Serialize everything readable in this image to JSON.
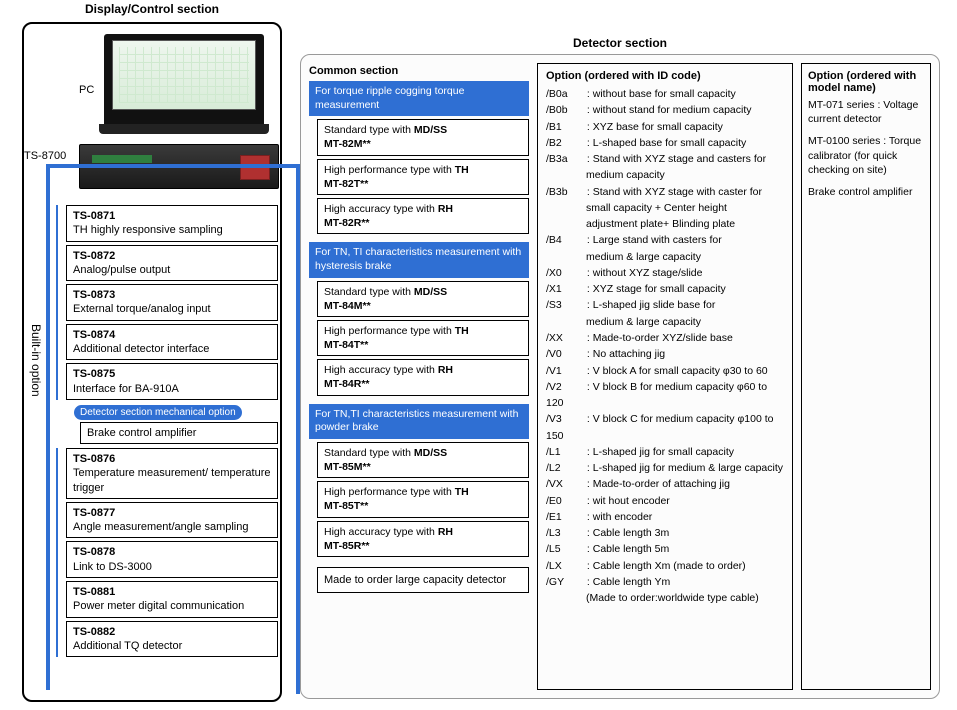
{
  "display": {
    "title": "Display/Control section",
    "pc_label": "PC",
    "ts_label": "TS-8700",
    "vert_label": "Built-in option",
    "options": [
      {
        "code": "TS-0871",
        "desc": "TH highly responsive sampling"
      },
      {
        "code": "TS-0872",
        "desc": "Analog/pulse output"
      },
      {
        "code": "TS-0873",
        "desc": "External torque/analog input"
      },
      {
        "code": "TS-0874",
        "desc": "Additional detector interface"
      },
      {
        "code": "TS-0875",
        "desc": "Interface for BA-910A"
      }
    ],
    "mech_header": "Detector section  mechanical option",
    "brake": "Brake control amplifier",
    "options2": [
      {
        "code": "TS-0876",
        "desc": "Temperature measurement/ temperature trigger"
      },
      {
        "code": "TS-0877",
        "desc": "Angle measurement/angle sampling"
      },
      {
        "code": "TS-0878",
        "desc": "Link to DS-3000"
      },
      {
        "code": "TS-0881",
        "desc": "Power meter digital communication"
      },
      {
        "code": "TS-0882",
        "desc": "Additional TQ detector"
      }
    ]
  },
  "detector": {
    "title": "Detector section",
    "common": {
      "title": "Common section",
      "groups": [
        {
          "head": "For torque ripple cogging torque measurement",
          "items": [
            {
              "label": "Standard type with MD/SS",
              "model": "MT-82M**"
            },
            {
              "label": "High performance type with TH",
              "model": "MT-82T**"
            },
            {
              "label": "High accuracy type with RH",
              "model": "MT-82R**"
            }
          ]
        },
        {
          "head": "For TN, TI characteristics measurement with hysteresis brake",
          "items": [
            {
              "label": "Standard type with MD/SS",
              "model": "MT-84M**"
            },
            {
              "label": "High performance type with TH",
              "model": "MT-84T**"
            },
            {
              "label": "High accuracy type with RH",
              "model": "MT-84R**"
            }
          ]
        },
        {
          "head": "For TN,TI characteristics measurement with powder brake",
          "items": [
            {
              "label": "Standard type with MD/SS",
              "model": "MT-85M**"
            },
            {
              "label": "High performance type with TH",
              "model": "MT-85T**"
            },
            {
              "label": "High accuracy type with RH",
              "model": "MT-85R**"
            }
          ]
        }
      ],
      "made": "Made to order large capacity detector"
    },
    "option": {
      "title": "Option (ordered with ID code)",
      "lines": [
        {
          "code": "/B0a",
          "text": ": without base for small capacity"
        },
        {
          "code": "/B0b",
          "text": ": without stand for medium capacity"
        },
        {
          "code": "/B1",
          "text": ": XYZ base for small capacity"
        },
        {
          "code": "/B2",
          "text": ": L-shaped base for small capacity"
        },
        {
          "code": "/B3a",
          "text": ": Stand with XYZ stage and casters for"
        },
        {
          "sub": "medium capacity"
        },
        {
          "code": "/B3b",
          "text": ": Stand with XYZ stage with caster for"
        },
        {
          "sub": "small capacity + Center height"
        },
        {
          "sub": "adjustment plate+ Blinding plate"
        },
        {
          "code": "/B4",
          "text": ": Large stand with casters for"
        },
        {
          "sub": "medium & large capacity"
        },
        {
          "code": "/X0",
          "text": ": without XYZ stage/slide"
        },
        {
          "code": "/X1",
          "text": ": XYZ stage for small capacity"
        },
        {
          "code": "/S3",
          "text": ": L-shaped jig slide base for"
        },
        {
          "sub": "medium & large capacity"
        },
        {
          "code": "/XX",
          "text": ": Made-to-order XYZ/slide base"
        },
        {
          "code": "/V0",
          "text": ": No attaching jig"
        },
        {
          "code": "/V1",
          "text": ": V block A for small capacity φ30 to 60"
        },
        {
          "code": "/V2",
          "text": ": V block B for medium capacity φ60 to 120"
        },
        {
          "code": "/V3",
          "text": ": V block C for medium capacity φ100 to 150"
        },
        {
          "code": "/L1",
          "text": ": L-shaped jig for small capacity"
        },
        {
          "code": "/L2",
          "text": ": L-shaped jig for medium & large capacity"
        },
        {
          "code": "/VX",
          "text": ": Made-to-order of attaching jig"
        },
        {
          "code": "/E0",
          "text": ": wit hout encoder"
        },
        {
          "code": "/E1",
          "text": ": with encoder"
        },
        {
          "code": "/L3",
          "text": ": Cable length 3m"
        },
        {
          "code": "/L5",
          "text": ": Cable length 5m"
        },
        {
          "code": "/LX",
          "text": ": Cable length Xm (made to order)"
        },
        {
          "code": "/GY",
          "text": ": Cable length Ym"
        },
        {
          "sub": "(Made to order:worldwide type cable)"
        }
      ]
    },
    "right": {
      "title": "Option (ordered with model name)",
      "blocks": [
        "MT-071 series : Voltage current detector",
        "MT-0100 series : Torque calibrator (for quick checking on site)",
        "Brake control amplifier"
      ]
    }
  }
}
